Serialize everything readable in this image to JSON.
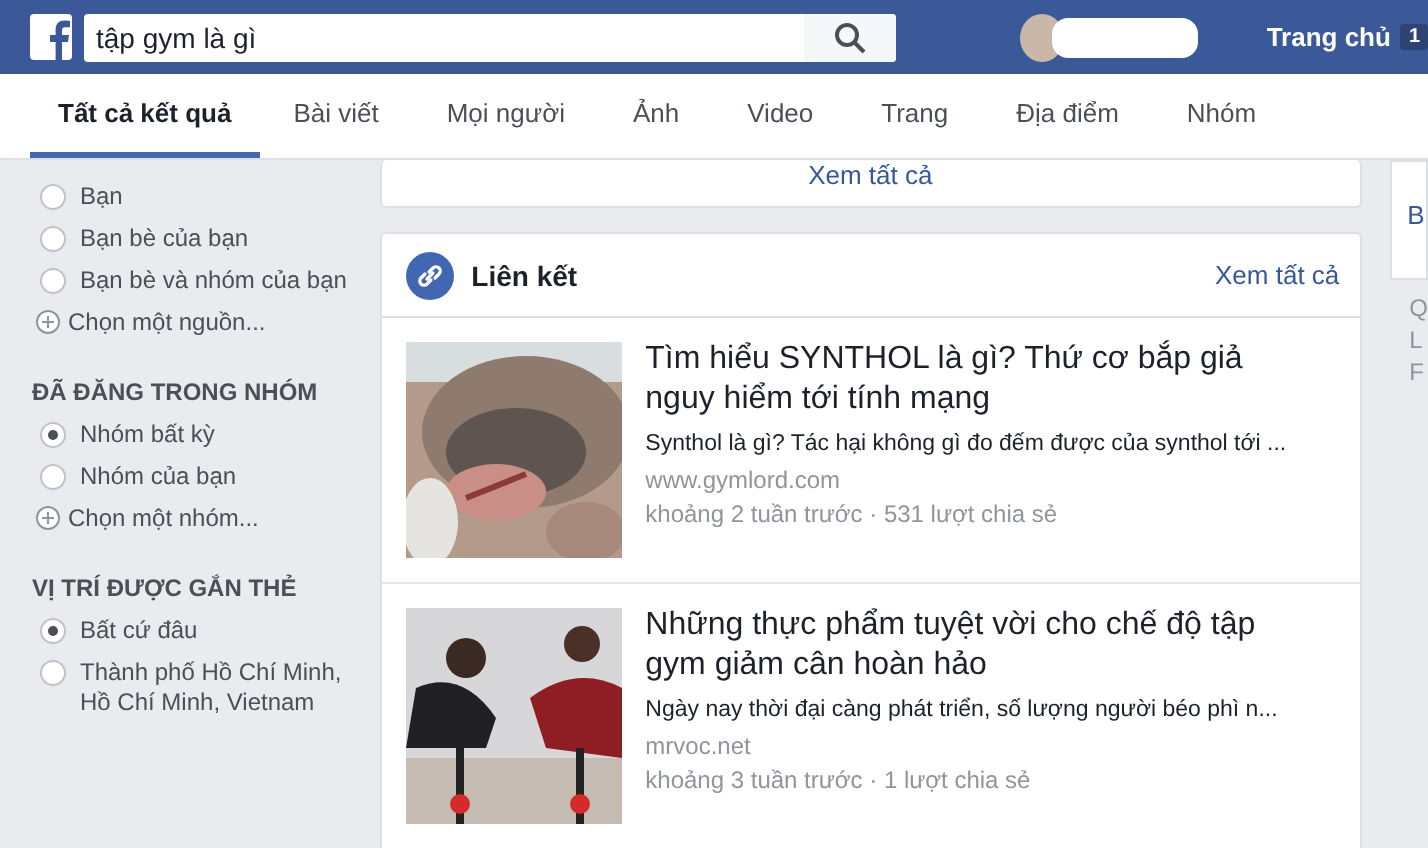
{
  "search": {
    "value": "tập gym là gì"
  },
  "header": {
    "home_label": "Trang chủ",
    "home_count": "1"
  },
  "tabs": [
    {
      "label": "Tất cả kết quả",
      "selected": true
    },
    {
      "label": "Bài viết",
      "selected": false
    },
    {
      "label": "Mọi người",
      "selected": false
    },
    {
      "label": "Ảnh",
      "selected": false
    },
    {
      "label": "Video",
      "selected": false
    },
    {
      "label": "Trang",
      "selected": false
    },
    {
      "label": "Địa điểm",
      "selected": false
    },
    {
      "label": "Nhóm",
      "selected": false
    }
  ],
  "sidebar": {
    "sections": [
      {
        "items": [
          {
            "kind": "radio",
            "label": "Bạn",
            "selected": false
          },
          {
            "kind": "radio",
            "label": "Bạn bè của bạn",
            "selected": false
          },
          {
            "kind": "radio",
            "label": "Bạn bè và nhóm của bạn",
            "selected": false
          },
          {
            "kind": "add",
            "label": "Chọn một nguồn..."
          }
        ]
      },
      {
        "title": "ĐÃ ĐĂNG TRONG NHÓM",
        "items": [
          {
            "kind": "radio",
            "label": "Nhóm bất kỳ",
            "selected": true
          },
          {
            "kind": "radio",
            "label": "Nhóm của bạn",
            "selected": false
          },
          {
            "kind": "add",
            "label": "Chọn một nhóm..."
          }
        ]
      },
      {
        "title": "VỊ TRÍ ĐƯỢC GẮN THẺ",
        "items": [
          {
            "kind": "radio",
            "label": "Bất cứ đâu",
            "selected": true
          },
          {
            "kind": "radio",
            "label": "Thành phố Hồ Chí Minh, Hồ Chí Minh, Vietnam",
            "selected": false
          }
        ]
      }
    ]
  },
  "previous_card": {
    "link": "Xem tất cả"
  },
  "links_card": {
    "title": "Liên kết",
    "see_all": "Xem tất cả",
    "items": [
      {
        "title": "Tìm hiểu SYNTHOL là gì? Thứ cơ bắp giả nguy hiểm tới tính mạng",
        "snippet": "Synthol là gì? Tác hại không gì đo đếm được của synthol tới ...",
        "domain": "www.gymlord.com",
        "meta": "khoảng 2 tuần trước · 531 lượt chia sẻ"
      },
      {
        "title": "Những thực phẩm tuyệt vời cho chế độ tập gym giảm cân hoàn hảo",
        "snippet": "Ngày nay thời đại càng phát triển, số lượng người béo phì n...",
        "domain": "mrvoc.net",
        "meta": "khoảng 3 tuần trước · 1 lượt chia sẻ"
      }
    ]
  },
  "right_column": {
    "link": "B",
    "lines": [
      "Q",
      "L",
      "F"
    ]
  }
}
